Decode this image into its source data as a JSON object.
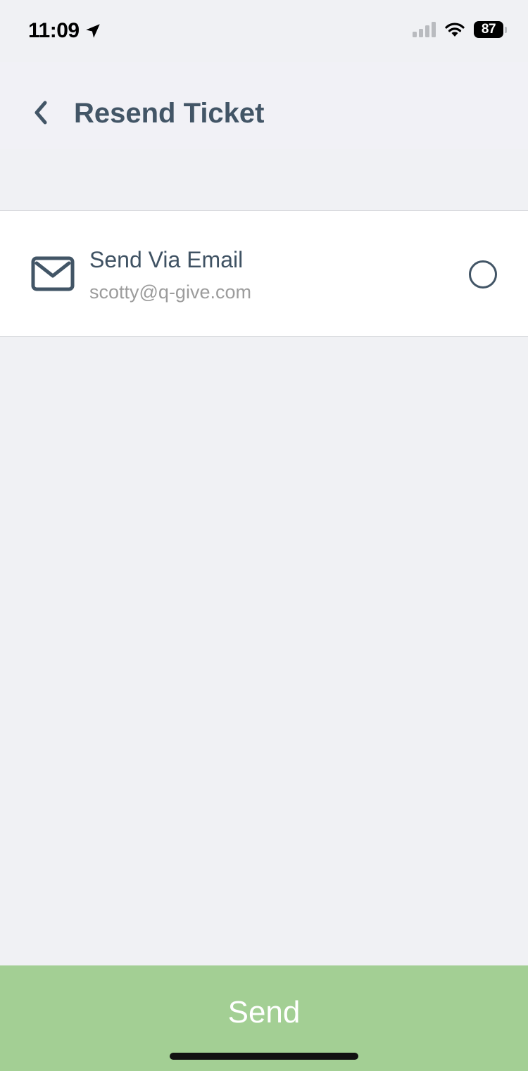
{
  "status_bar": {
    "time": "11:09",
    "battery_level": "87",
    "icons": [
      "location-arrow-icon",
      "cellular-signal-icon",
      "wifi-icon",
      "battery-icon"
    ]
  },
  "header": {
    "title": "Resend Ticket",
    "back_icon": "chevron-left-icon"
  },
  "option": {
    "title": "Send Via Email",
    "subtitle": "scotty@q-give.com",
    "icon": "mail-icon",
    "selected": false
  },
  "action": {
    "send_label": "Send"
  },
  "colors": {
    "title_text": "#425566",
    "send_button": "#a3cf94",
    "background": "#f0f1f4"
  }
}
